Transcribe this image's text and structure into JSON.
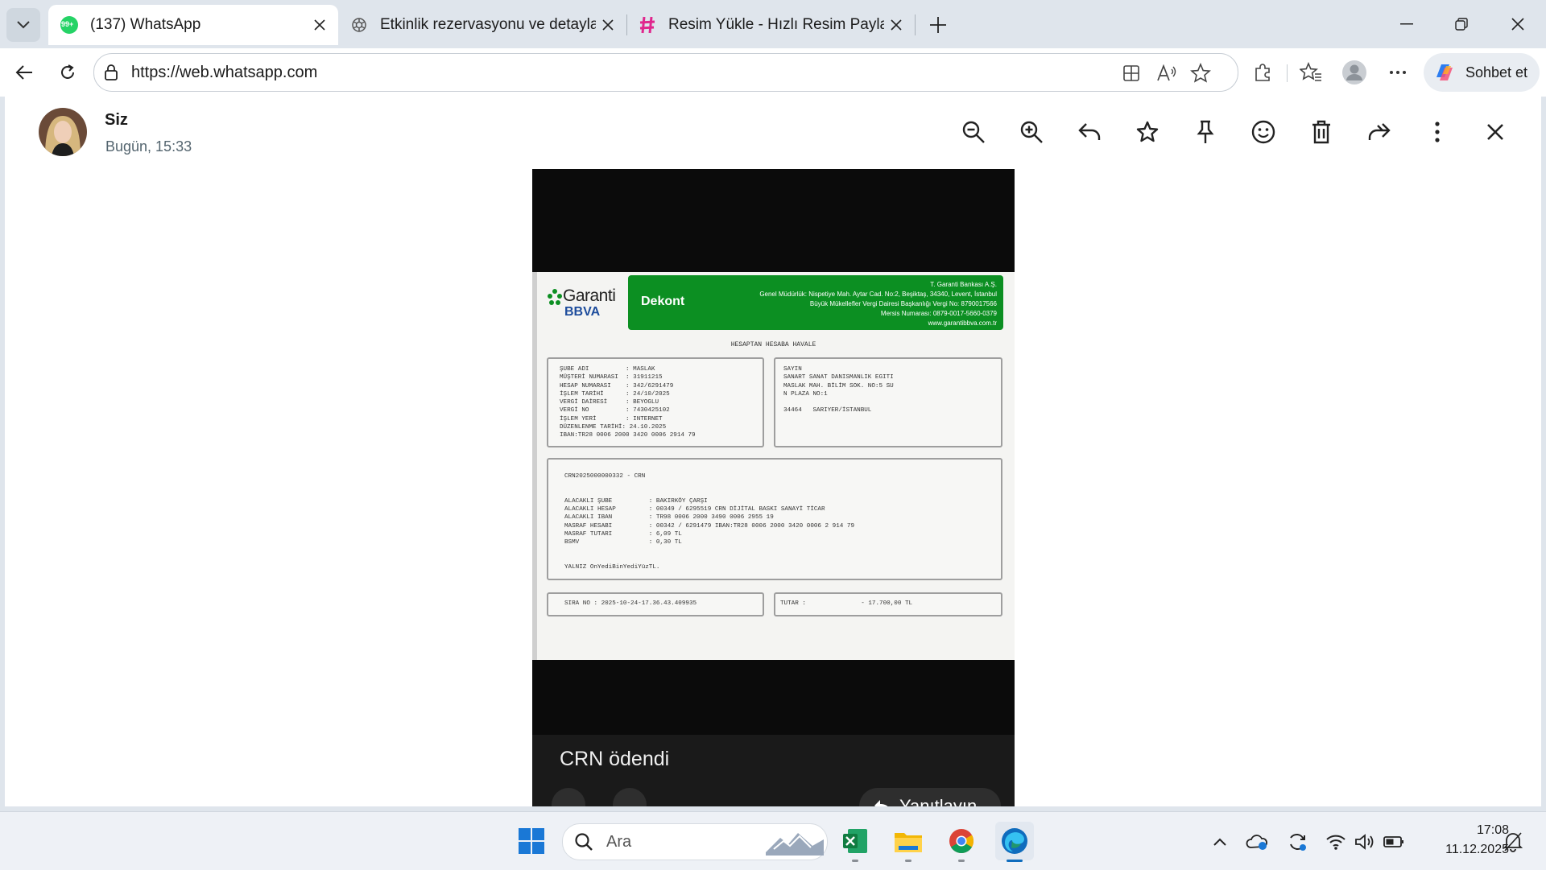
{
  "browser": {
    "tabs": [
      {
        "title": "(137) WhatsApp",
        "badge": "99+",
        "active": true
      },
      {
        "title": "Etkinlik rezervasyonu ve detaylar",
        "active": false
      },
      {
        "title": "Resim Yükle - Hızlı Resim Paylaş - R",
        "active": false
      }
    ],
    "url": "https://web.whatsapp.com",
    "copilot_label": "Sohbet et"
  },
  "viewer": {
    "sender": "Siz",
    "timestamp": "Bugün, 15:33",
    "caption": "CRN ödendi",
    "reply_label": "Yanıtlayın"
  },
  "document": {
    "banner_label": "Dekont",
    "logo_main": "Garanti",
    "logo_sub": "BBVA",
    "bank_header": "T. Garanti Bankası A.Ş.\nGenel Müdürlük: Nispetiye Mah. Aytar Cad. No:2, Beşiktaş, 34340, Levent, İstanbul\nBüyük Mükellefler Vergi Dairesi Başkanlığı Vergi No: 8790017566\nMersis Numarası: 0879-0017-5660-0379\nwww.garantibbva.com.tr",
    "title": "HESAPTAN HESABA HAVALE",
    "customer_block": "ŞUBE ADI          : MASLAK\nMÜŞTERİ NUMARASI  : 31911215\nHESAP NUMARASI    : 342/6291479\nİŞLEM TARİHİ      : 24/10/2025\nVERGİ DAİRESİ     : BEYOGLU\nVERGİ NO          : 7430425102\nİŞLEM YERİ        : INTERNET\nDÜZENLENME TARİHİ: 24.10.2025\nIBAN:TR28 0006 2000 3420 0006 2914 79",
    "address_block": "SAYIN\nSANART SANAT DANISMANLIK EGITI\nMASLAK MAH. BİLİM SOK. NO:5 SU\nN PLAZA NO:1\n\n34464   SARIYER/İSTANBUL",
    "transfer_block": "CRN2025000000332 - CRN\n\n\nALACAKLI ŞUBE          : BAKIRKÖY ÇARŞI\nALACAKLI HESAP         : 00349 / 6295519 CRN DİJİTAL BASKI SANAYİ TİCAR\nALACAKLI IBAN          : TR98 0006 2000 3490 0006 2955 19\nMASRAF HESABI          : 00342 / 6291479 IBAN:TR28 0006 2000 3420 0006 2 914 79\nMASRAF TUTARI          : 6,09 TL\nBSMV                   : 0,30 TL\n\n\nYALNIZ OnYediBinYediYüzTL.",
    "sira_no": "SIRA NO : 2025-10-24-17.36.43.409935",
    "tutar": "TUTAR :               - 17.700,00 TL"
  },
  "taskbar": {
    "search_placeholder": "Ara",
    "time": "17:08",
    "date": "11.12.2025"
  },
  "colors": {
    "whatsapp_green": "#25d366",
    "garanti_green": "#0c8f22",
    "edge_blue": "#0f6cbd",
    "tab_strip": "#dfe5ec"
  },
  "icons": [
    "tab-list-icon",
    "whatsapp-icon",
    "openai-icon",
    "imgbb-icon",
    "close-icon",
    "plus-icon",
    "minimize-icon",
    "restore-icon",
    "back-icon",
    "refresh-icon",
    "lock-icon",
    "split-screen-icon",
    "read-aloud-icon",
    "favorite-star-icon",
    "extensions-icon",
    "favorites-icon",
    "profile-icon",
    "more-icon",
    "copilot-icon",
    "zoom-out-icon",
    "zoom-in-icon",
    "reply-icon",
    "star-icon",
    "pin-icon",
    "emoji-icon",
    "delete-icon",
    "forward-icon",
    "windows-start-icon",
    "search-icon",
    "excel-icon",
    "file-explorer-icon",
    "chrome-icon",
    "edge-icon",
    "chevron-up-icon",
    "onedrive-icon",
    "sync-icon",
    "wifi-icon",
    "volume-icon",
    "battery-icon",
    "notification-icon"
  ]
}
